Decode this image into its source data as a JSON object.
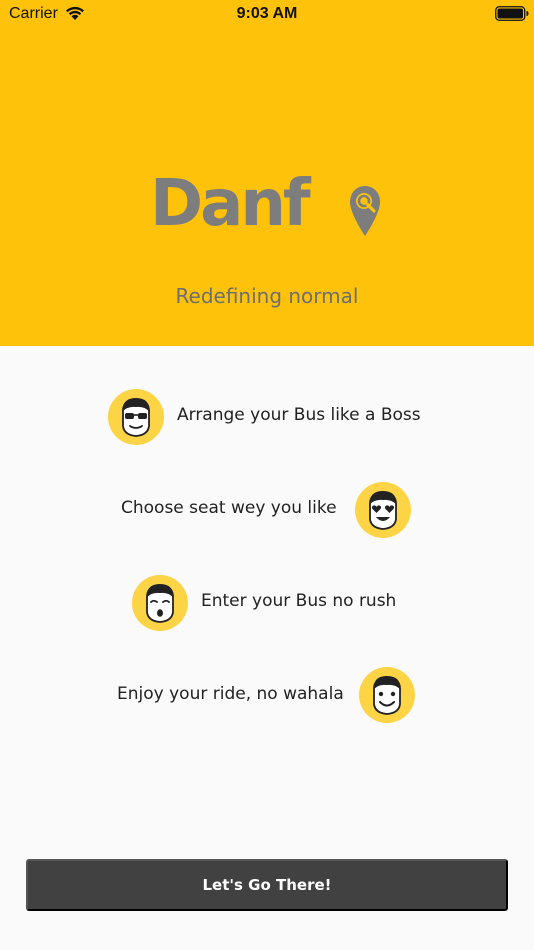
{
  "status_bar": {
    "carrier": "Carrier",
    "time": "9:03 AM"
  },
  "brand": {
    "name": "Danfo",
    "name_lettering": "Danf",
    "tagline": "Redefining normal",
    "accent_color": "#ffc20a",
    "logo_color": "#7d7d7d"
  },
  "features": [
    {
      "text": "Arrange your Bus like a Boss",
      "icon": "sunglasses-face-icon"
    },
    {
      "text": "Choose seat wey you like",
      "icon": "heart-eyes-face-icon"
    },
    {
      "text": "Enter your Bus no rush",
      "icon": "surprised-face-icon"
    },
    {
      "text": "Enjoy your ride, no wahala",
      "icon": "smiling-face-icon"
    }
  ],
  "cta": {
    "label": "Let's Go There!",
    "color": "#414141"
  }
}
